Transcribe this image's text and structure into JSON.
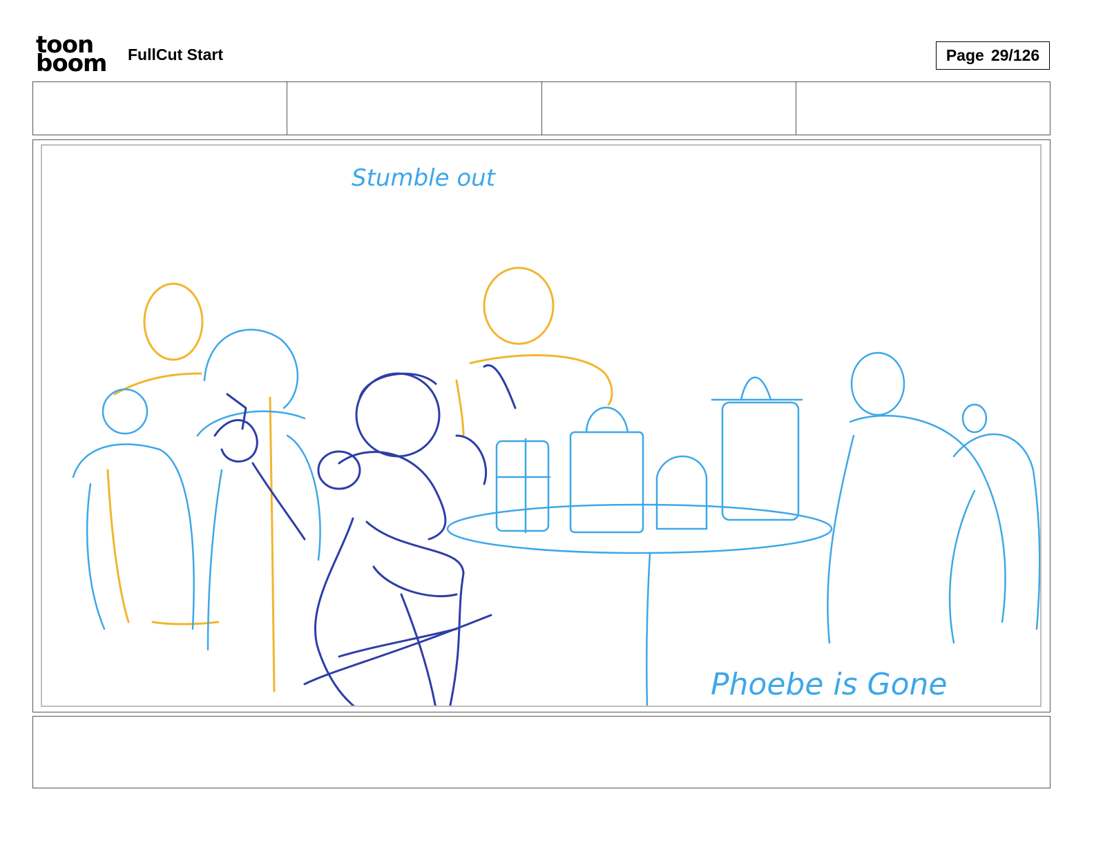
{
  "header": {
    "logo_line1": "toon",
    "logo_line2": "boom",
    "title": "FullCut Start",
    "page_label": "Page",
    "page_number": "29/126"
  },
  "panel": {
    "annotation_top": "Stumble out",
    "annotation_bottom": "Phoebe is Gone"
  },
  "colors": {
    "sketch_blue": "#3da7e8",
    "sketch_orange": "#f2b52f",
    "sketch_navy": "#2d3ea6"
  }
}
